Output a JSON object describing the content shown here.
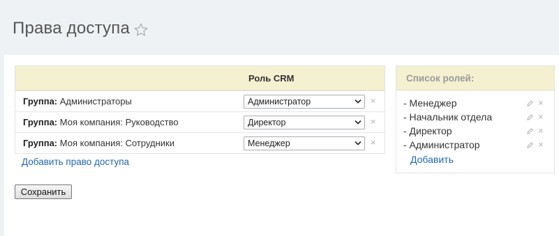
{
  "page": {
    "title": "Права доступа"
  },
  "rights_table": {
    "column_title": "Роль CRM",
    "rows": [
      {
        "label_bold": "Группа:",
        "label": "Администраторы",
        "role": "Администратор"
      },
      {
        "label_bold": "Группа:",
        "label": "Моя компания: Руководство",
        "role": "Директор"
      },
      {
        "label_bold": "Группа:",
        "label": "Моя компания: Сотрудники",
        "role": "Менеджер"
      }
    ],
    "remove_glyph": "×",
    "add_link": "Добавить право доступа"
  },
  "save_label": "Сохранить",
  "roles_panel": {
    "title": "Список ролей:",
    "items": [
      "- Менеджер",
      "- Начальник отдела",
      "- Директор",
      "- Администратор"
    ],
    "delete_glyph": "×",
    "add_link": "Добавить"
  },
  "colors": {
    "header_bg": "#f4f0d0",
    "link": "#2067b0",
    "page_bg": "#eef2f4"
  }
}
